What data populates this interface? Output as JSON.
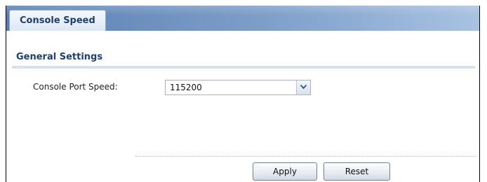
{
  "tabs": [
    {
      "label": "Console Speed",
      "active": true
    }
  ],
  "section": {
    "title": "General Settings"
  },
  "form": {
    "console_port_speed": {
      "label": "Console Port Speed:",
      "value": "115200"
    }
  },
  "actions": {
    "apply_label": "Apply",
    "reset_label": "Reset"
  },
  "colors": {
    "accent": "#1f3f73",
    "tabbar": "#7d9fc9"
  }
}
